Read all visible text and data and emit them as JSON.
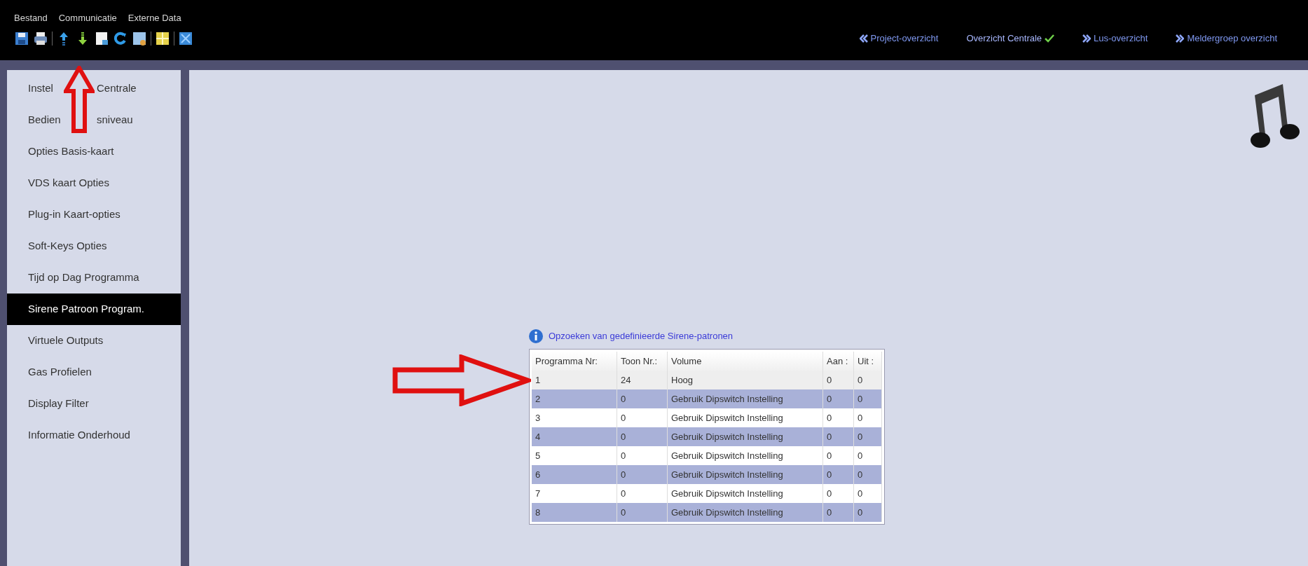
{
  "menu": [
    "Bestand",
    "Communicatie",
    "Externe Data"
  ],
  "nav_links": [
    {
      "label": "Project-overzicht",
      "kind": "back",
      "selected": false
    },
    {
      "label": "Overzicht Centrale",
      "kind": "current",
      "selected": true
    },
    {
      "label": "Lus-overzicht",
      "kind": "forward",
      "selected": false
    },
    {
      "label": "Meldergroep overzicht",
      "kind": "forward",
      "selected": false
    }
  ],
  "sidebar": {
    "items": [
      {
        "parts": [
          "Instel",
          "Centrale"
        ],
        "selected": false
      },
      {
        "parts": [
          "Bedien",
          "sniveau"
        ],
        "selected": false
      },
      {
        "label": "Opties Basis-kaart",
        "selected": false
      },
      {
        "label": "VDS kaart Opties",
        "selected": false
      },
      {
        "label": "Plug-in Kaart-opties",
        "selected": false
      },
      {
        "label": "Soft-Keys Opties",
        "selected": false
      },
      {
        "label": "Tijd op Dag Programma",
        "selected": false
      },
      {
        "label": "Sirene Patroon Program.",
        "selected": true
      },
      {
        "label": "Virtuele Outputs",
        "selected": false
      },
      {
        "label": "Gas Profielen",
        "selected": false
      },
      {
        "label": "Display Filter",
        "selected": false
      },
      {
        "label": "Informatie Onderhoud",
        "selected": false
      }
    ]
  },
  "lookup_link": "Opzoeken van gedefinieerde Sirene-patronen",
  "table": {
    "columns": [
      "Programma Nr:",
      "Toon Nr.:",
      "Volume",
      "Aan :",
      "Uit :"
    ],
    "rows": [
      {
        "cells": [
          "1",
          "24",
          "Hoog",
          "0",
          "0"
        ],
        "selected": true
      },
      {
        "cells": [
          "2",
          "0",
          "Gebruik Dipswitch Instelling",
          "0",
          "0"
        ],
        "selected": false
      },
      {
        "cells": [
          "3",
          "0",
          "Gebruik Dipswitch Instelling",
          "0",
          "0"
        ],
        "selected": false
      },
      {
        "cells": [
          "4",
          "0",
          "Gebruik Dipswitch Instelling",
          "0",
          "0"
        ],
        "selected": false
      },
      {
        "cells": [
          "5",
          "0",
          "Gebruik Dipswitch Instelling",
          "0",
          "0"
        ],
        "selected": false
      },
      {
        "cells": [
          "6",
          "0",
          "Gebruik Dipswitch Instelling",
          "0",
          "0"
        ],
        "selected": false
      },
      {
        "cells": [
          "7",
          "0",
          "Gebruik Dipswitch Instelling",
          "0",
          "0"
        ],
        "selected": false
      },
      {
        "cells": [
          "8",
          "0",
          "Gebruik Dipswitch Instelling",
          "0",
          "0"
        ],
        "selected": false
      }
    ]
  }
}
